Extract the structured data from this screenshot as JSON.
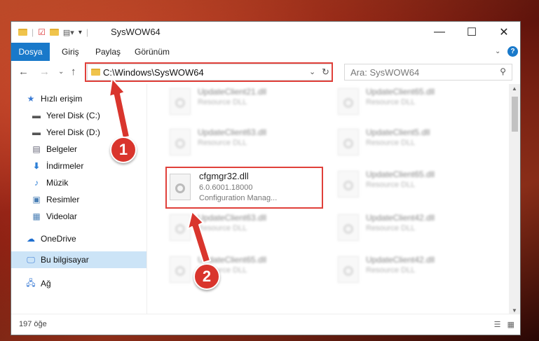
{
  "window": {
    "title": "SysWOW64",
    "controls": [
      "—",
      "☐",
      "✕"
    ]
  },
  "ribbon": {
    "tabs": [
      "Dosya",
      "Giriş",
      "Paylaş",
      "Görünüm"
    ]
  },
  "address": {
    "path": "C:\\Windows\\SysWOW64",
    "search_placeholder": "Ara: SysWOW64"
  },
  "sidebar": {
    "items": [
      {
        "label": "Hızlı erişim",
        "icon": "star-icon"
      },
      {
        "label": "Yerel Disk (C:)",
        "icon": "drive-icon"
      },
      {
        "label": "Yerel Disk (D:)",
        "icon": "drive-icon"
      },
      {
        "label": "Belgeler",
        "icon": "documents-icon"
      },
      {
        "label": "İndirmeler",
        "icon": "download-icon"
      },
      {
        "label": "Müzik",
        "icon": "music-icon"
      },
      {
        "label": "Resimler",
        "icon": "pictures-icon"
      },
      {
        "label": "Videolar",
        "icon": "video-icon"
      },
      {
        "label": "OneDrive",
        "icon": "cloud-icon"
      },
      {
        "label": "Bu bilgisayar",
        "icon": "computer-icon"
      },
      {
        "label": "Ağ",
        "icon": "network-icon"
      }
    ]
  },
  "files": {
    "left": [
      {
        "name": "UpdateClient21.dll",
        "sub": "Resource DLL"
      },
      {
        "name": "UpdateClient63.dll",
        "sub": "Resource DLL"
      },
      {
        "name": "UpdateClient63.dll",
        "sub": "Resource DLL"
      },
      {
        "name": "UpdateClient65.dll",
        "sub": "Resource DLL"
      }
    ],
    "right": [
      {
        "name": "UpdateClient65.dll",
        "sub": "Resource DLL"
      },
      {
        "name": "UpdateClient5.dll",
        "sub": "Resource DLL"
      },
      {
        "name": "UpdateClient65.dll",
        "sub": "Resource DLL"
      },
      {
        "name": "UpdateClient42.dll",
        "sub": "Resource DLL"
      },
      {
        "name": "UpdateClient42.dll",
        "sub": "Resource DLL"
      }
    ],
    "highlighted": {
      "name": "cfgmgr32.dll",
      "version": "6.0.6001.18000",
      "description": "Configuration Manag..."
    }
  },
  "status": {
    "count": "197 öğe"
  },
  "annotations": {
    "step1": "1",
    "step2": "2",
    "color": "#e0403a"
  }
}
